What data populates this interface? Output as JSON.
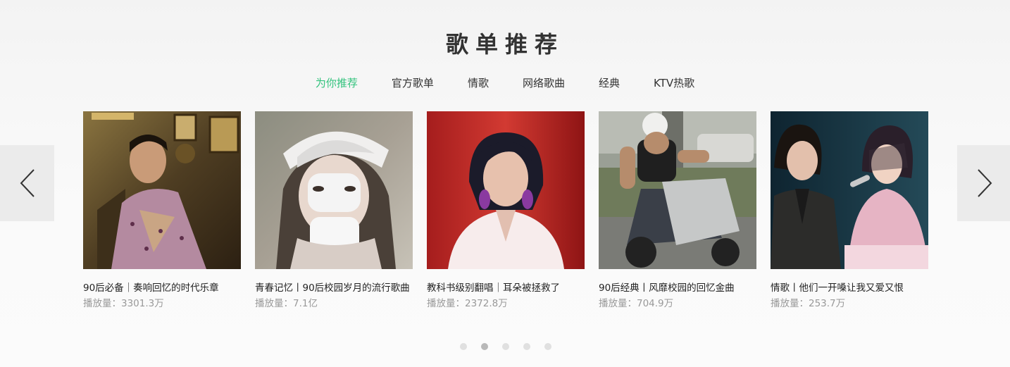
{
  "section": {
    "title": "歌单推荐"
  },
  "tabs": [
    {
      "label": "为你推荐",
      "active": true
    },
    {
      "label": "官方歌单",
      "active": false
    },
    {
      "label": "情歌",
      "active": false
    },
    {
      "label": "网络歌曲",
      "active": false
    },
    {
      "label": "经典",
      "active": false
    },
    {
      "label": "KTV热歌",
      "active": false
    }
  ],
  "nav": {
    "prev_icon": "chevron-left-icon",
    "next_icon": "chevron-right-icon"
  },
  "playlists": [
    {
      "title": "90后必备｜奏响回忆的时代乐章",
      "plays": "播放量：3301.3万"
    },
    {
      "title": "青春记忆丨90后校园岁月的流行歌曲",
      "plays": "播放量：7.1亿"
    },
    {
      "title": "教科书级别翻唱｜耳朵被拯救了",
      "plays": "播放量：2372.8万"
    },
    {
      "title": "90后经典丨风靡校园的回忆金曲",
      "plays": "播放量：704.9万"
    },
    {
      "title": "情歌丨他们一开嗓让我又爱又恨",
      "plays": "播放量：253.7万"
    }
  ],
  "pagination": {
    "count": 5,
    "active_index": 1
  },
  "colors": {
    "accent": "#31c27c",
    "text": "#333333",
    "muted": "#999999"
  }
}
